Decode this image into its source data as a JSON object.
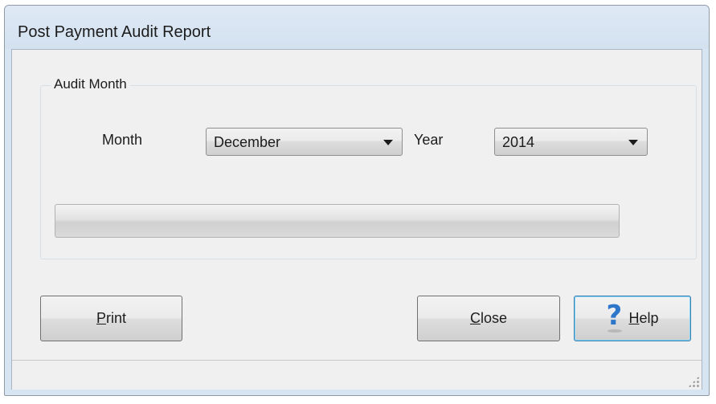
{
  "window": {
    "title": "Post Payment Audit Report"
  },
  "audit_group": {
    "legend": "Audit Month",
    "month_label": "Month",
    "month_value": "December",
    "year_label": "Year",
    "year_value": "2014"
  },
  "progress": {
    "value_percent": 0
  },
  "buttons": {
    "print_mnemonic": "P",
    "print_rest": "rint",
    "close_mnemonic": "C",
    "close_rest": "lose",
    "help_mnemonic": "H",
    "help_rest": "elp",
    "help_icon": "question-mark-icon"
  },
  "colors": {
    "default_button_border": "#3c7fb1",
    "help_icon_color": "#2e76c9"
  }
}
